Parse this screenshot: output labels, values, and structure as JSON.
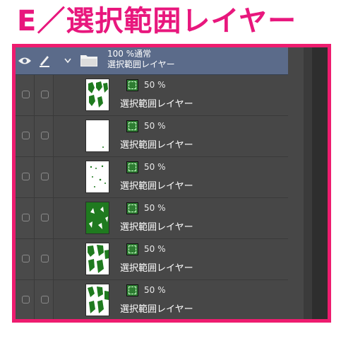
{
  "heading": "E／選択範囲レイヤー",
  "folder": {
    "opacity_blend": "100 %通常",
    "name": "選択範囲レイヤー"
  },
  "layers": [
    {
      "opacity": "50 %",
      "name": "選択範囲レイヤー"
    },
    {
      "opacity": "50 %",
      "name": "選択範囲レイヤー"
    },
    {
      "opacity": "50 %",
      "name": "選択範囲レイヤー"
    },
    {
      "opacity": "50 %",
      "name": "選択範囲レイヤー"
    },
    {
      "opacity": "50 %",
      "name": "選択範囲レイヤー"
    },
    {
      "opacity": "50 %",
      "name": "選択範囲レイヤー"
    }
  ],
  "colors": {
    "accent": "#ee1c6f",
    "folder_row": "#5b6b8a",
    "panel": "#474747",
    "mask": "#2e7d32"
  },
  "icons": [
    "eye-icon",
    "pen-icon",
    "chevron-down-icon",
    "folder-icon",
    "selection-mask-icon",
    "visibility-checkbox",
    "lock-checkbox"
  ]
}
